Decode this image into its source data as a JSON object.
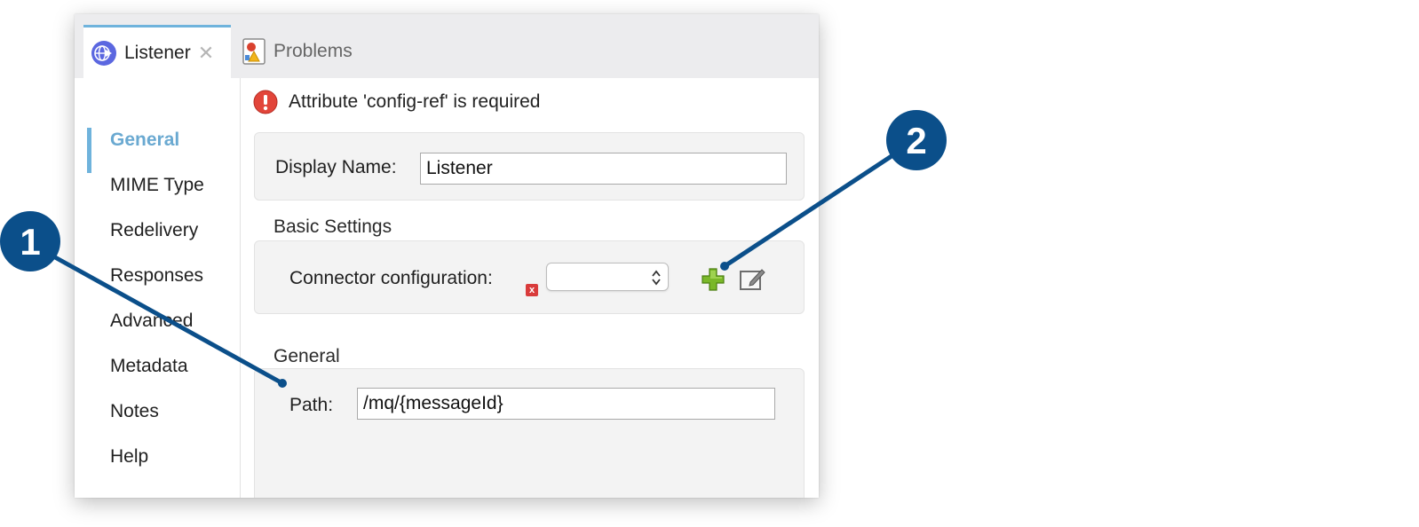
{
  "tabs": [
    {
      "label": "Listener",
      "icon": "globe-arrow-icon",
      "active": true,
      "close": "✕"
    },
    {
      "label": "Problems",
      "icon": "problems-icon",
      "active": false
    }
  ],
  "sidebar": {
    "items": [
      {
        "label": "General",
        "active": true
      },
      {
        "label": "MIME Type"
      },
      {
        "label": "Redelivery"
      },
      {
        "label": "Responses"
      },
      {
        "label": "Advanced"
      },
      {
        "label": "Metadata"
      },
      {
        "label": "Notes"
      },
      {
        "label": "Help"
      }
    ]
  },
  "error": {
    "icon": "error-icon",
    "message": "Attribute 'config-ref' is required"
  },
  "display_name": {
    "label": "Display Name:",
    "value": "Listener"
  },
  "basic_settings": {
    "title": "Basic Settings",
    "connector_label": "Connector configuration:",
    "connector_value": "",
    "required_marker": "x"
  },
  "general_section": {
    "title": "General",
    "path_label": "Path:",
    "path_value": "/mq/{messageId}"
  },
  "callouts": [
    {
      "number": "1",
      "points_to": "path-field"
    },
    {
      "number": "2",
      "points_to": "add-config-button"
    }
  ],
  "colors": {
    "accent": "#6fb3dc",
    "callout": "#0b4f8a",
    "error": "#e2453a",
    "add_green": "#7ab829"
  }
}
